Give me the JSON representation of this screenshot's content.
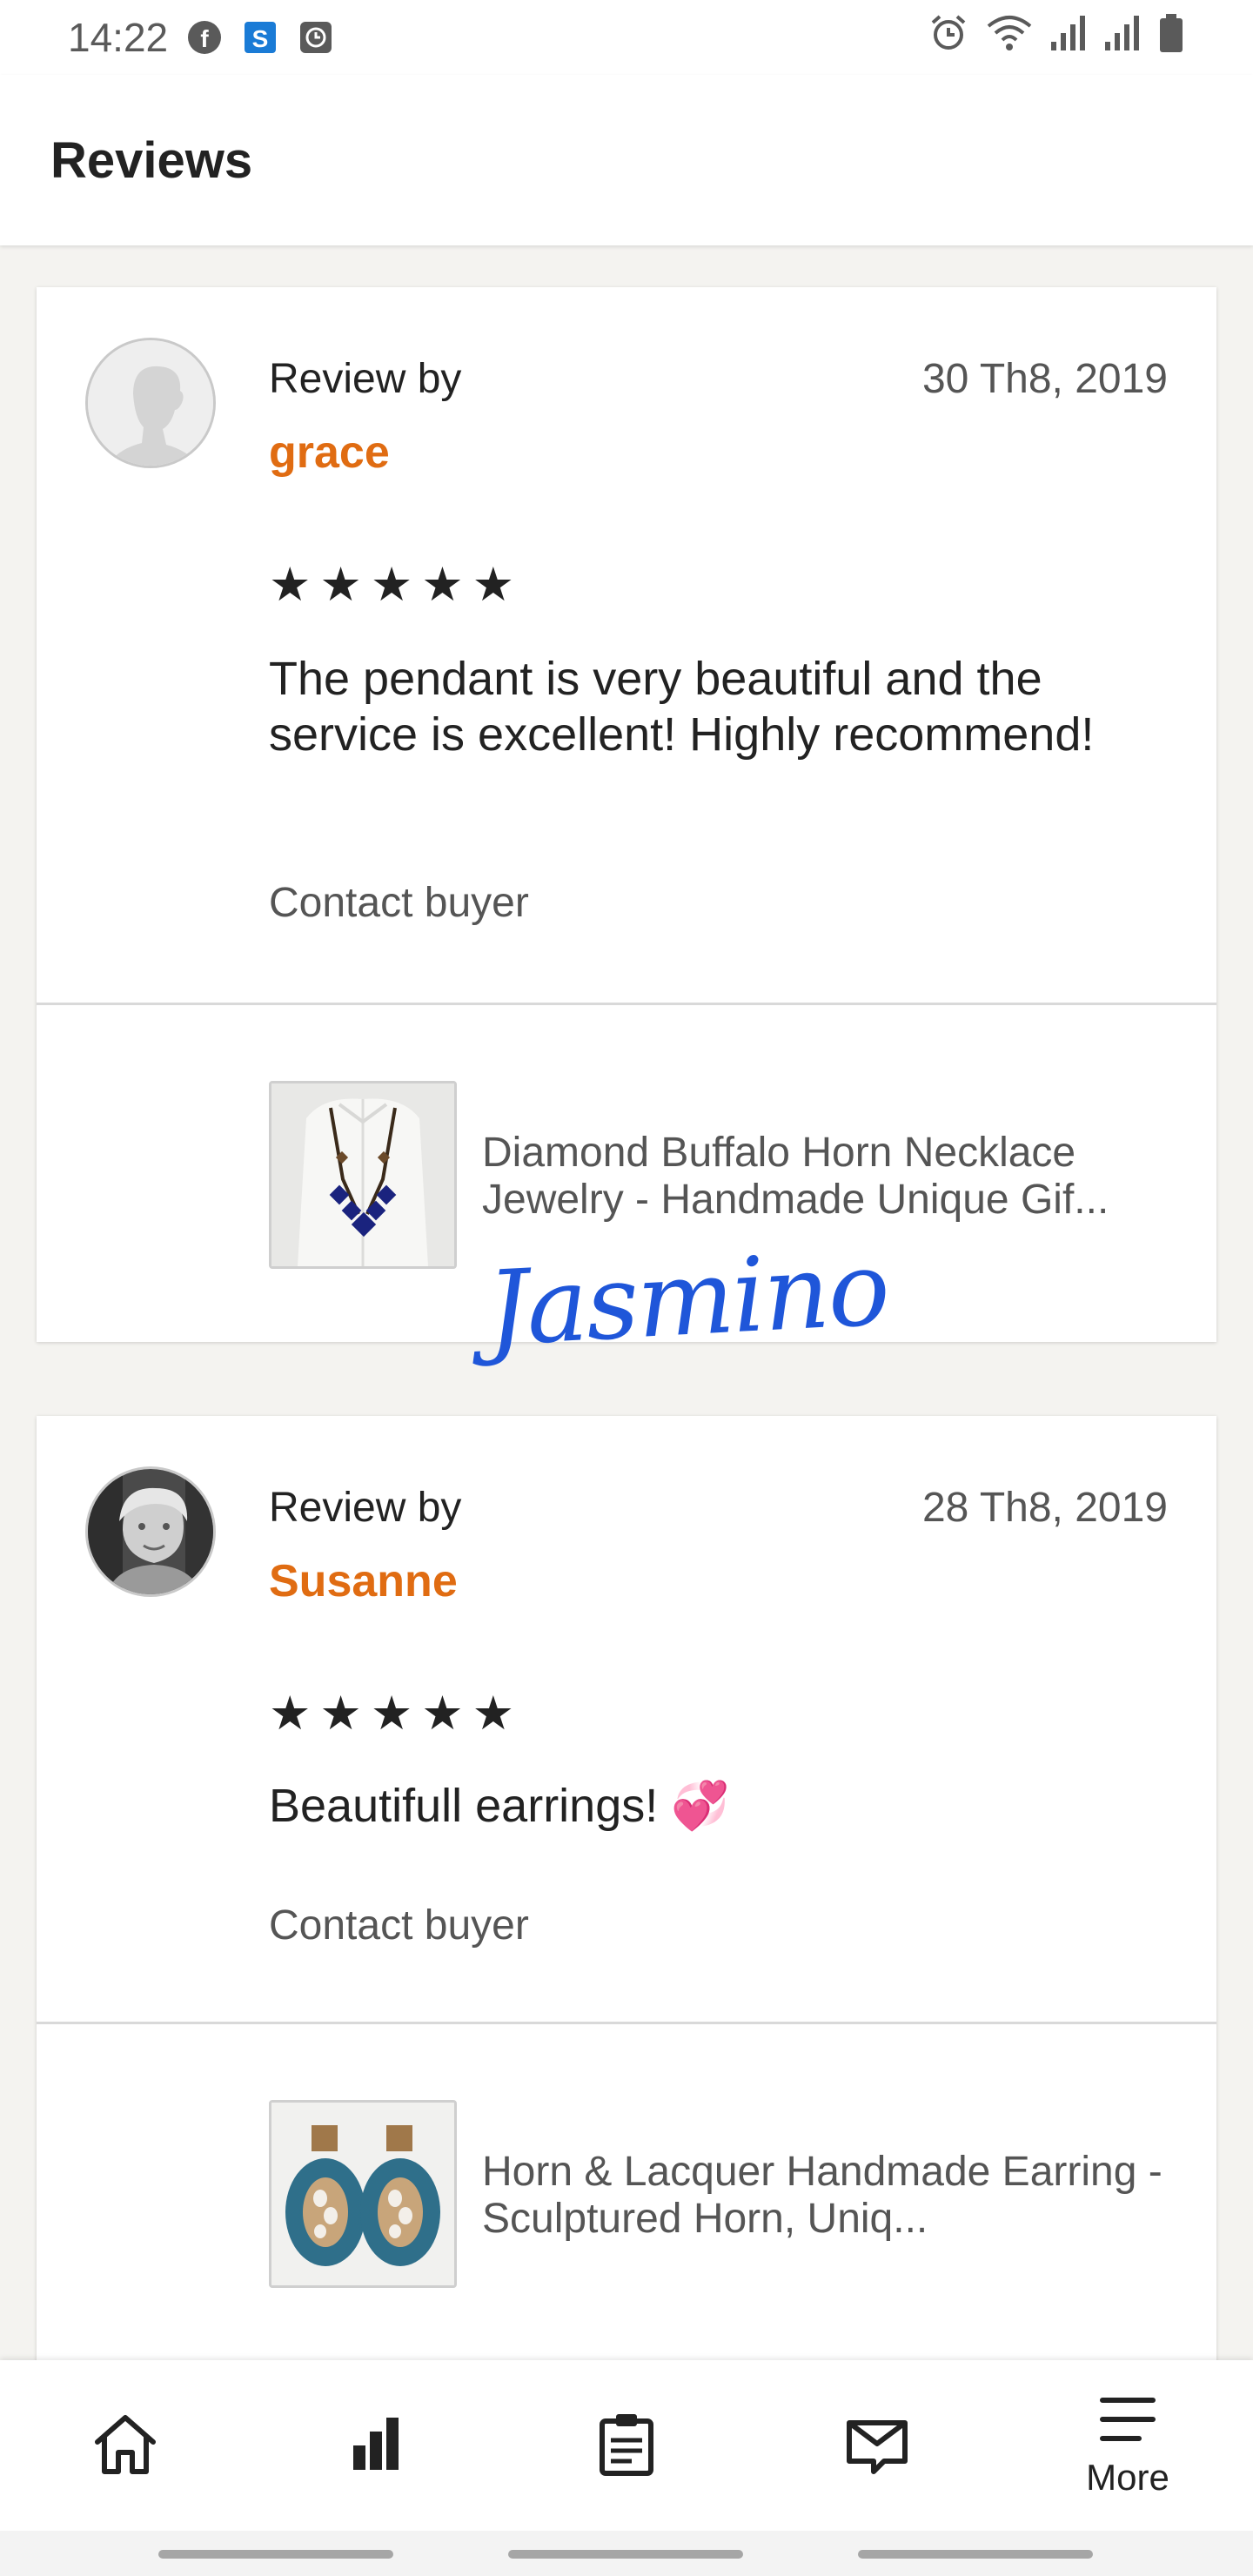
{
  "status_bar": {
    "time": "14:22",
    "left_icons": [
      "facebook-icon",
      "s-app-icon",
      "clock-app-icon"
    ],
    "right_icons": [
      "alarm-icon",
      "wifi-icon",
      "signal-icon",
      "signal-icon",
      "battery-icon"
    ]
  },
  "app_bar": {
    "title": "Reviews"
  },
  "reviews": [
    {
      "review_by_label": "Review by",
      "reviewer": "grace",
      "date": "30 Th8, 2019",
      "stars": "★★★★★",
      "rating": 5,
      "text": "The pendant is very beautiful and the service is excellent! Highly recommend!",
      "contact_label": "Contact buyer",
      "product_title": "Diamond Buffalo Horn Necklace Jewelry - Handmade Unique Gif...",
      "signature": "Jasmino"
    },
    {
      "review_by_label": "Review by",
      "reviewer": "Susanne",
      "date": "28 Th8, 2019",
      "stars": "★★★★★",
      "rating": 5,
      "text": "Beautifull earrings! 💞",
      "contact_label": "Contact buyer",
      "product_title": "Horn & Lacquer Handmade Earring - Sculptured Horn, Uniq..."
    }
  ],
  "bottom_nav": {
    "items": [
      {
        "icon": "home-icon"
      },
      {
        "icon": "stats-icon"
      },
      {
        "icon": "orders-icon"
      },
      {
        "icon": "messages-icon"
      },
      {
        "icon": "menu-icon",
        "label": "More"
      }
    ]
  },
  "colors": {
    "accent": "#e06c12",
    "signature": "#1f56d9",
    "background": "#f4f3f0"
  }
}
